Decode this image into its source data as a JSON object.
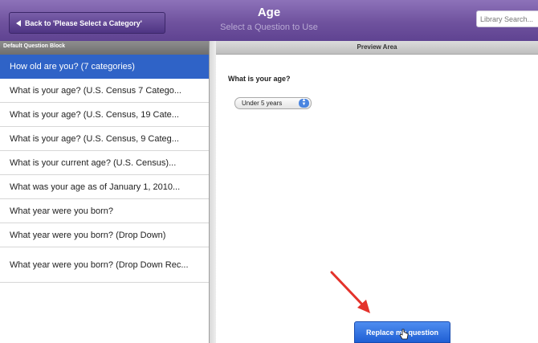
{
  "header": {
    "back_label": "Back to 'Please Select a Category'",
    "title": "Age",
    "subtitle": "Select a Question to Use",
    "search_placeholder": "Library Search..."
  },
  "sidebar": {
    "heading": "Default Question Block",
    "items": [
      {
        "label": "How old are you? (7 categories)",
        "selected": true
      },
      {
        "label": "What is your age? (U.S. Census 7 Catego..."
      },
      {
        "label": "What is your age? (U.S. Census, 19 Cate..."
      },
      {
        "label": "What is your age? (U.S. Census, 9 Categ..."
      },
      {
        "label": "What is your current age? (U.S. Census)..."
      },
      {
        "label": "What was your age as of January 1, 2010..."
      },
      {
        "label": "What year were you born?"
      },
      {
        "label": "What year were you born? (Drop Down)"
      },
      {
        "label": "What year were you born? (Drop Down Rec..."
      }
    ]
  },
  "preview": {
    "heading": "Preview Area",
    "question_text": "What is your age?",
    "dropdown_value": "Under 5 years",
    "replace_label": "Replace my question"
  },
  "colors": {
    "header_purple": "#6f529e",
    "selected_blue": "#2f63c7",
    "arrow_red": "#e4322b"
  }
}
